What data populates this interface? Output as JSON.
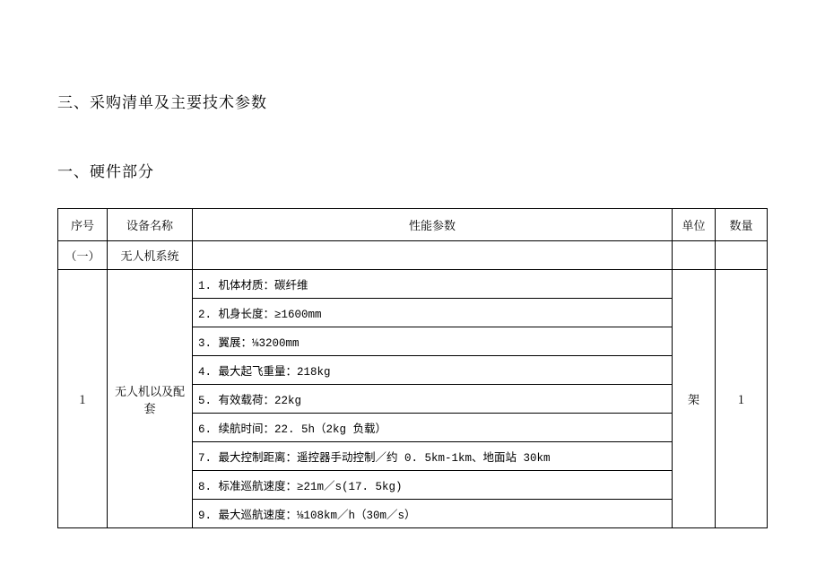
{
  "title": "三、采购清单及主要技术参数",
  "subtitle": "一、硬件部分",
  "headers": {
    "index": "序号",
    "name": "设备名称",
    "spec": "性能参数",
    "unit": "单位",
    "qty": "数量"
  },
  "rows": {
    "group": {
      "index": "（一）",
      "name": "无人机系统"
    },
    "item1": {
      "index": "1",
      "name": "无人机以及配套",
      "unit": "架",
      "qty": "1",
      "specs": [
        "1. 机体材质：碳纤维",
        "2. 机身长度：≥1600mm",
        "3. 翼展：⅛3200mm",
        "4. 最大起飞重量：218kg",
        "5. 有效载荷：22kg",
        "6. 续航时间：22. 5h（2kg 负载）",
        "7. 最大控制距离：遥控器手动控制／约 0. 5km-1km、地面站 30km",
        "8. 标准巡航速度：≥21m／s(17. 5kg)",
        "9. 最大巡航速度：⅛108km／h（30m／s）"
      ]
    }
  }
}
